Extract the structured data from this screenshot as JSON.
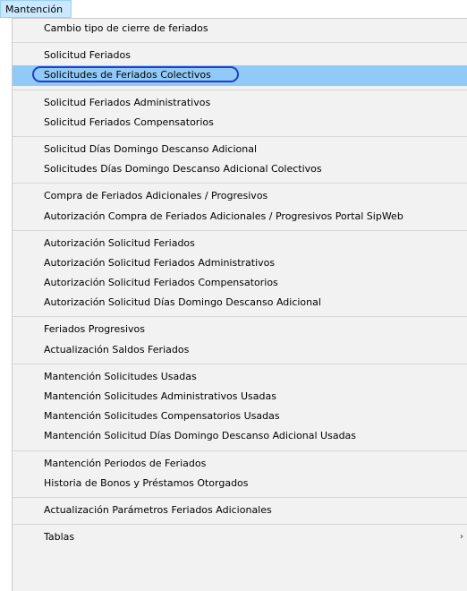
{
  "menubar": {
    "title": "Mantención"
  },
  "menu": {
    "groups": [
      {
        "items": [
          {
            "label": "Cambio tipo de cierre de feriados"
          }
        ]
      },
      {
        "items": [
          {
            "label": "Solicitud Feriados"
          },
          {
            "label": "Solicitudes de Feriados Colectivos",
            "highlighted": true
          }
        ]
      },
      {
        "items": [
          {
            "label": "Solicitud Feriados Administrativos"
          },
          {
            "label": "Solicitud Feriados Compensatorios"
          }
        ]
      },
      {
        "items": [
          {
            "label": "Solicitud Días Domingo Descanso Adicional"
          },
          {
            "label": "Solicitudes Días Domingo Descanso Adicional Colectivos"
          }
        ]
      },
      {
        "items": [
          {
            "label": "Compra de Feriados Adicionales / Progresivos"
          },
          {
            "label": "Autorización Compra de Feriados Adicionales / Progresivos Portal SipWeb"
          }
        ]
      },
      {
        "items": [
          {
            "label": "Autorización Solicitud Feriados"
          },
          {
            "label": "Autorización Solicitud Feriados Administrativos"
          },
          {
            "label": "Autorización Solicitud Feriados Compensatorios"
          },
          {
            "label": "Autorización Solicitud Días Domingo Descanso Adicional"
          }
        ]
      },
      {
        "items": [
          {
            "label": "Feriados Progresivos"
          },
          {
            "label": "Actualización Saldos Feriados"
          }
        ]
      },
      {
        "items": [
          {
            "label": "Mantención Solicitudes Usadas"
          },
          {
            "label": "Mantención Solicitudes Administrativos Usadas"
          },
          {
            "label": "Mantención Solicitudes Compensatorios Usadas"
          },
          {
            "label": "Mantención Solicitud Días Domingo Descanso Adicional Usadas"
          }
        ]
      },
      {
        "items": [
          {
            "label": "Mantención Periodos de Feriados"
          },
          {
            "label": "Historia de Bonos y Préstamos Otorgados"
          }
        ]
      },
      {
        "items": [
          {
            "label": "Actualización Parámetros Feriados Adicionales"
          }
        ]
      },
      {
        "items": [
          {
            "label": "Tablas",
            "submenu_arrow": "›"
          }
        ]
      }
    ]
  },
  "colors": {
    "menu_background": "#f2f2f2",
    "highlight_background": "#91c9f7",
    "highlight_ring": "#1f3fd1",
    "menubar_active": "#cce8ff"
  }
}
